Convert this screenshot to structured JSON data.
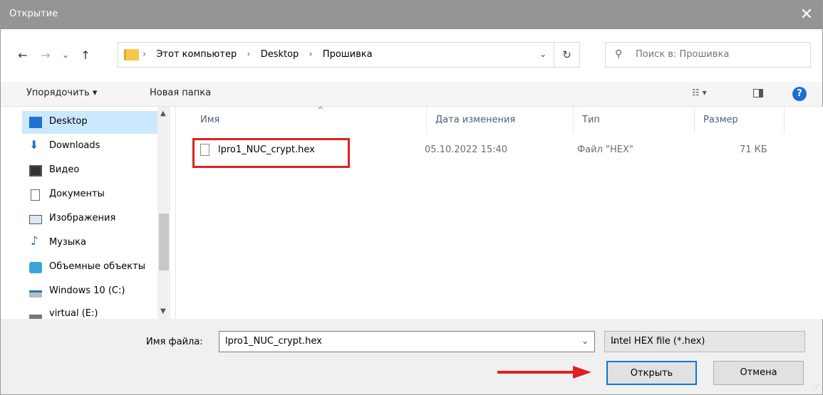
{
  "window": {
    "title": "Открытие",
    "close_glyph": "✕"
  },
  "nav": {
    "back_glyph": "←",
    "forward_glyph": "→",
    "recent_glyph": "⌄",
    "up_glyph": "↑",
    "crumbs": [
      "Этот компьютер",
      "Desktop",
      "Прошивка"
    ],
    "crumb_sep": "›",
    "dropdown_glyph": "⌄",
    "refresh_glyph": "↻",
    "search_placeholder": "Поиск в: Прошивка",
    "search_glyph": "⚲"
  },
  "toolbar": {
    "organize_label": "Упорядочить ▾",
    "new_folder_label": "Новая папка",
    "view_glyph": "☷ ▾",
    "help_glyph": "?"
  },
  "sidebar": {
    "up_arrow": "▲",
    "down_arrow": "▼",
    "items": [
      {
        "label": "Desktop",
        "icon": "desktop-icon"
      },
      {
        "label": "Downloads",
        "icon": "download-icon"
      },
      {
        "label": "Видео",
        "icon": "video-icon"
      },
      {
        "label": "Документы",
        "icon": "documents-icon"
      },
      {
        "label": "Изображения",
        "icon": "images-icon"
      },
      {
        "label": "Музыка",
        "icon": "music-icon"
      },
      {
        "label": "Объемные объекты",
        "icon": "3d-objects-icon"
      },
      {
        "label": "Windows 10 (C:)",
        "icon": "drive-icon"
      },
      {
        "label": "virtual (E:)",
        "icon": "drive-icon"
      }
    ]
  },
  "files": {
    "columns": [
      "Имя",
      "Дата изменения",
      "Тип",
      "Размер"
    ],
    "sort_glyph": "^",
    "rows": [
      {
        "name": "lpro1_NUC_crypt.hex",
        "date": "05.10.2022 15:40",
        "type": "Файл \"HEX\"",
        "size": "71 КБ"
      }
    ]
  },
  "bottom": {
    "filename_label": "Имя файла:",
    "filename_value": "lpro1_NUC_crypt.hex",
    "filename_drop": "⌄",
    "filetype_value": "Intel HEX file (*.hex)",
    "filetype_drop": "⌄",
    "open_label": "Открыть",
    "cancel_label": "Отмена",
    "grip_glyph": "⋰"
  },
  "colors": {
    "accent": "#0078d7",
    "annotation": "#e02020",
    "selection": "#cce8ff"
  }
}
